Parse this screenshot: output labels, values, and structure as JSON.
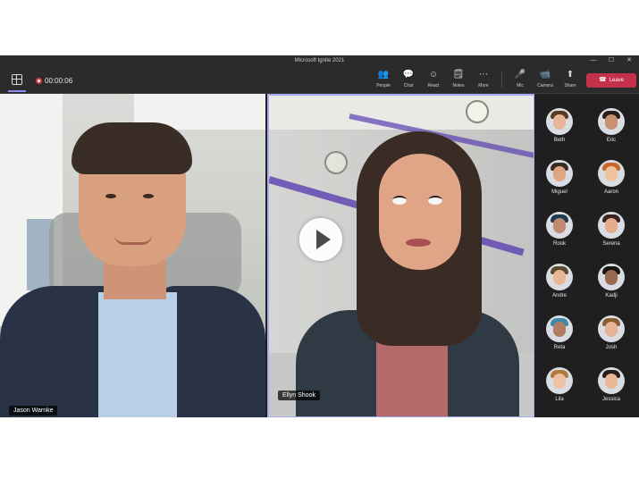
{
  "window": {
    "title": "Microsoft Ignite 2021",
    "controls": [
      "minimize-icon",
      "maximize-icon",
      "close-icon"
    ]
  },
  "toolbar": {
    "recording_time": "00:00:06",
    "tools": [
      {
        "name": "people",
        "label": "People",
        "icon": "👥"
      },
      {
        "name": "chat",
        "label": "Chat",
        "icon": "💬"
      },
      {
        "name": "react",
        "label": "React",
        "icon": "☺"
      },
      {
        "name": "notes",
        "label": "Notes",
        "icon": "🗒"
      },
      {
        "name": "more",
        "label": "More",
        "icon": "⋯"
      }
    ],
    "media": [
      {
        "name": "mic",
        "label": "Mic",
        "icon": "🎤"
      },
      {
        "name": "camera",
        "label": "Camera",
        "icon": "📹"
      },
      {
        "name": "share",
        "label": "Share",
        "icon": "⬆"
      }
    ],
    "leave_label": "Leave",
    "accent_color": "#8b8cf0",
    "leave_color": "#c4314b"
  },
  "stage": {
    "left_video_name": "Jason Warnke",
    "center_video_name": "Ellyn Shook",
    "center_border_color": "#a8a9f0"
  },
  "participants": [
    {
      "name": "Beth",
      "skin": "#e8b59a",
      "hair": "#5a3a22"
    },
    {
      "name": "Eric",
      "skin": "#c99072",
      "hair": "#2a1e18"
    },
    {
      "name": "Miguel",
      "skin": "#e0a583",
      "hair": "#3a2a20"
    },
    {
      "name": "Aaron",
      "skin": "#f0c3a0",
      "hair": "#c7662a"
    },
    {
      "name": "Rook",
      "skin": "#c08a70",
      "hair": "#203a50"
    },
    {
      "name": "Serena",
      "skin": "#e3ad8e",
      "hair": "#3a2320"
    },
    {
      "name": "Andre",
      "skin": "#e8b896",
      "hair": "#5a4a30"
    },
    {
      "name": "Kadji",
      "skin": "#9a6a50",
      "hair": "#1a1410"
    },
    {
      "name": "Reta",
      "skin": "#b27d63",
      "hair": "#3a8aa8"
    },
    {
      "name": "Josh",
      "skin": "#e6b494",
      "hair": "#8a5a30"
    },
    {
      "name": "Lila",
      "skin": "#edc1a2",
      "hair": "#b07a3a"
    },
    {
      "name": "Jessica",
      "skin": "#e9b798",
      "hair": "#2a1c16"
    }
  ]
}
